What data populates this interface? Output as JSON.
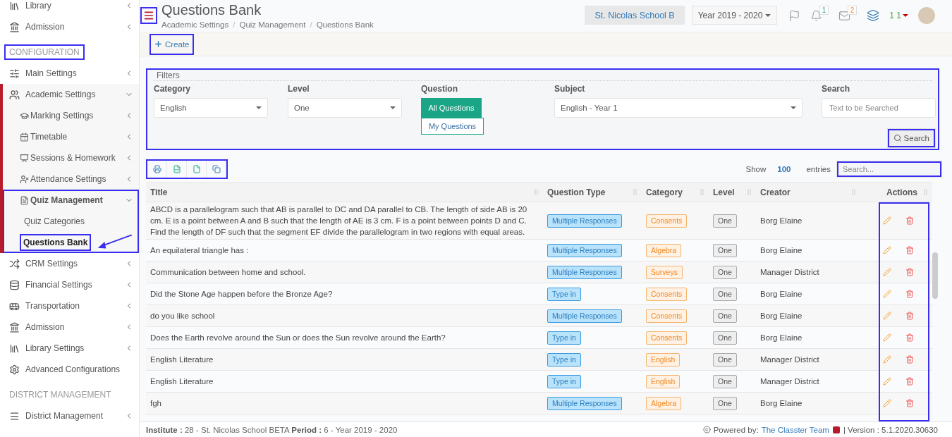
{
  "sidebar": {
    "sections": [
      {
        "items": [
          {
            "label": "Library",
            "expanded": false,
            "selected": false
          },
          {
            "label": "Admission",
            "expanded": false,
            "selected": false
          }
        ]
      },
      {
        "title": "CONFIGURATION",
        "highlighted": true,
        "items": [
          {
            "label": "Main Settings",
            "expanded": false,
            "selected": false
          },
          {
            "label": "Academic Settings",
            "expanded": true,
            "selected": false,
            "children": [
              {
                "label": "Marking Settings",
                "expanded": false,
                "selected": false
              },
              {
                "label": "Timetable",
                "expanded": false,
                "selected": false
              },
              {
                "label": "Sessions & Homework",
                "expanded": false,
                "selected": false
              },
              {
                "label": "Attendance Settings",
                "expanded": false,
                "selected": false
              },
              {
                "label": "Quiz Management",
                "expanded": true,
                "selected": false,
                "highlighted": true,
                "children": [
                  {
                    "label": "Quiz Categories",
                    "selected": false,
                    "highlighted": false
                  },
                  {
                    "label": "Questions Bank",
                    "selected": true,
                    "highlighted": true
                  }
                ]
              }
            ]
          },
          {
            "label": "CRM Settings",
            "expanded": false,
            "selected": false
          },
          {
            "label": "Financial Settings",
            "expanded": false,
            "selected": false
          },
          {
            "label": "Transportation",
            "expanded": false,
            "selected": false
          },
          {
            "label": "Admission",
            "expanded": false,
            "selected": false
          },
          {
            "label": "Library Settings",
            "expanded": false,
            "selected": false
          },
          {
            "label": "Advanced Configurations",
            "selected": false
          }
        ]
      },
      {
        "title": "DISTRICT MANAGEMENT",
        "highlighted": false,
        "items": [
          {
            "label": "District Management",
            "expanded": false,
            "selected": false
          }
        ]
      }
    ]
  },
  "header": {
    "menu_highlighted": true,
    "title": "Questions Bank",
    "breadcrumbs": [
      "Academic Settings",
      "Quiz Management",
      "Questions Bank"
    ],
    "breadcrumb_separator": "/",
    "school": "St. Nicolas School B",
    "year": "Year 2019 - 2020",
    "notifications": "1",
    "messages": "2",
    "user": "1 1"
  },
  "create": {
    "label": "Create",
    "highlighted": true
  },
  "filters": {
    "legend": "Filters",
    "highlighted": true,
    "category": {
      "label": "Category",
      "value": "English"
    },
    "level": {
      "label": "Level",
      "value": "One"
    },
    "question": {
      "label": "Question",
      "options": [
        {
          "label": "All Questions",
          "selected": true
        },
        {
          "label": "My Questions",
          "selected": false
        }
      ]
    },
    "subject": {
      "label": "Subject",
      "value": "English - Year 1"
    },
    "search": {
      "label": "Search",
      "placeholder": "Text to be Searched"
    },
    "button": {
      "label": "Search",
      "highlighted": true
    }
  },
  "toolbar": {
    "highlighted": true,
    "show": "Show",
    "entries_count": "100",
    "entries": "entries",
    "search": {
      "placeholder": "Search...",
      "highlighted": true
    }
  },
  "table": {
    "columns": [
      {
        "label": "Title"
      },
      {
        "label": "Question Type"
      },
      {
        "label": "Category"
      },
      {
        "label": "Level"
      },
      {
        "label": "Creator"
      },
      {
        "label": "Actions",
        "highlighted": true
      }
    ],
    "rows": [
      {
        "title": "ABCD is a parallelogram such that AB is parallel to DC and DA parallel to CB. The length of side AB is 20 cm. E is a point between A and B such that the length of AE is 3 cm. F is a point between points D and C. Find the length of DF such that the segment EF divide the parallelogram in two regions with equal areas.",
        "type": "Multiple Responses",
        "category": "Consents",
        "level": "One",
        "creator": "Borg Elaine"
      },
      {
        "title": "An equilateral triangle has :",
        "type": "Multiple Responses",
        "category": "Algebra",
        "level": "One",
        "creator": "Borg Elaine"
      },
      {
        "title": "Communication between home and school.",
        "type": "Multiple Responses",
        "category": "Surveys",
        "level": "One",
        "creator": "Manager District"
      },
      {
        "title": "Did the Stone Age happen before the Bronze Age?",
        "type": "Type in",
        "category": "Consents",
        "level": "One",
        "creator": "Borg Elaine"
      },
      {
        "title": "do you like school",
        "type": "Multiple Responses",
        "category": "Consents",
        "level": "One",
        "creator": "Borg Elaine"
      },
      {
        "title": "Does the Earth revolve around the Sun or does the Sun revolve around the Earth?",
        "type": "Type in",
        "category": "Consents",
        "level": "One",
        "creator": "Borg Elaine"
      },
      {
        "title": "English Literature",
        "type": "Type in",
        "category": "English",
        "level": "One",
        "creator": "Manager District"
      },
      {
        "title": "English Literature",
        "type": "Type in",
        "category": "English",
        "level": "One",
        "creator": "Manager District"
      },
      {
        "title": "fgh",
        "type": "Multiple Responses",
        "category": "Algebra",
        "level": "One",
        "creator": "Borg Elaine"
      }
    ]
  },
  "footer": {
    "info": "**Institute :** 28 - St. Nicolas School BETA **Period :** 6 - Year 2019 - 2020",
    "powered": "Powered by:",
    "team": "The Classter Team",
    "version": "| Version : 5.1.2020.30630"
  }
}
